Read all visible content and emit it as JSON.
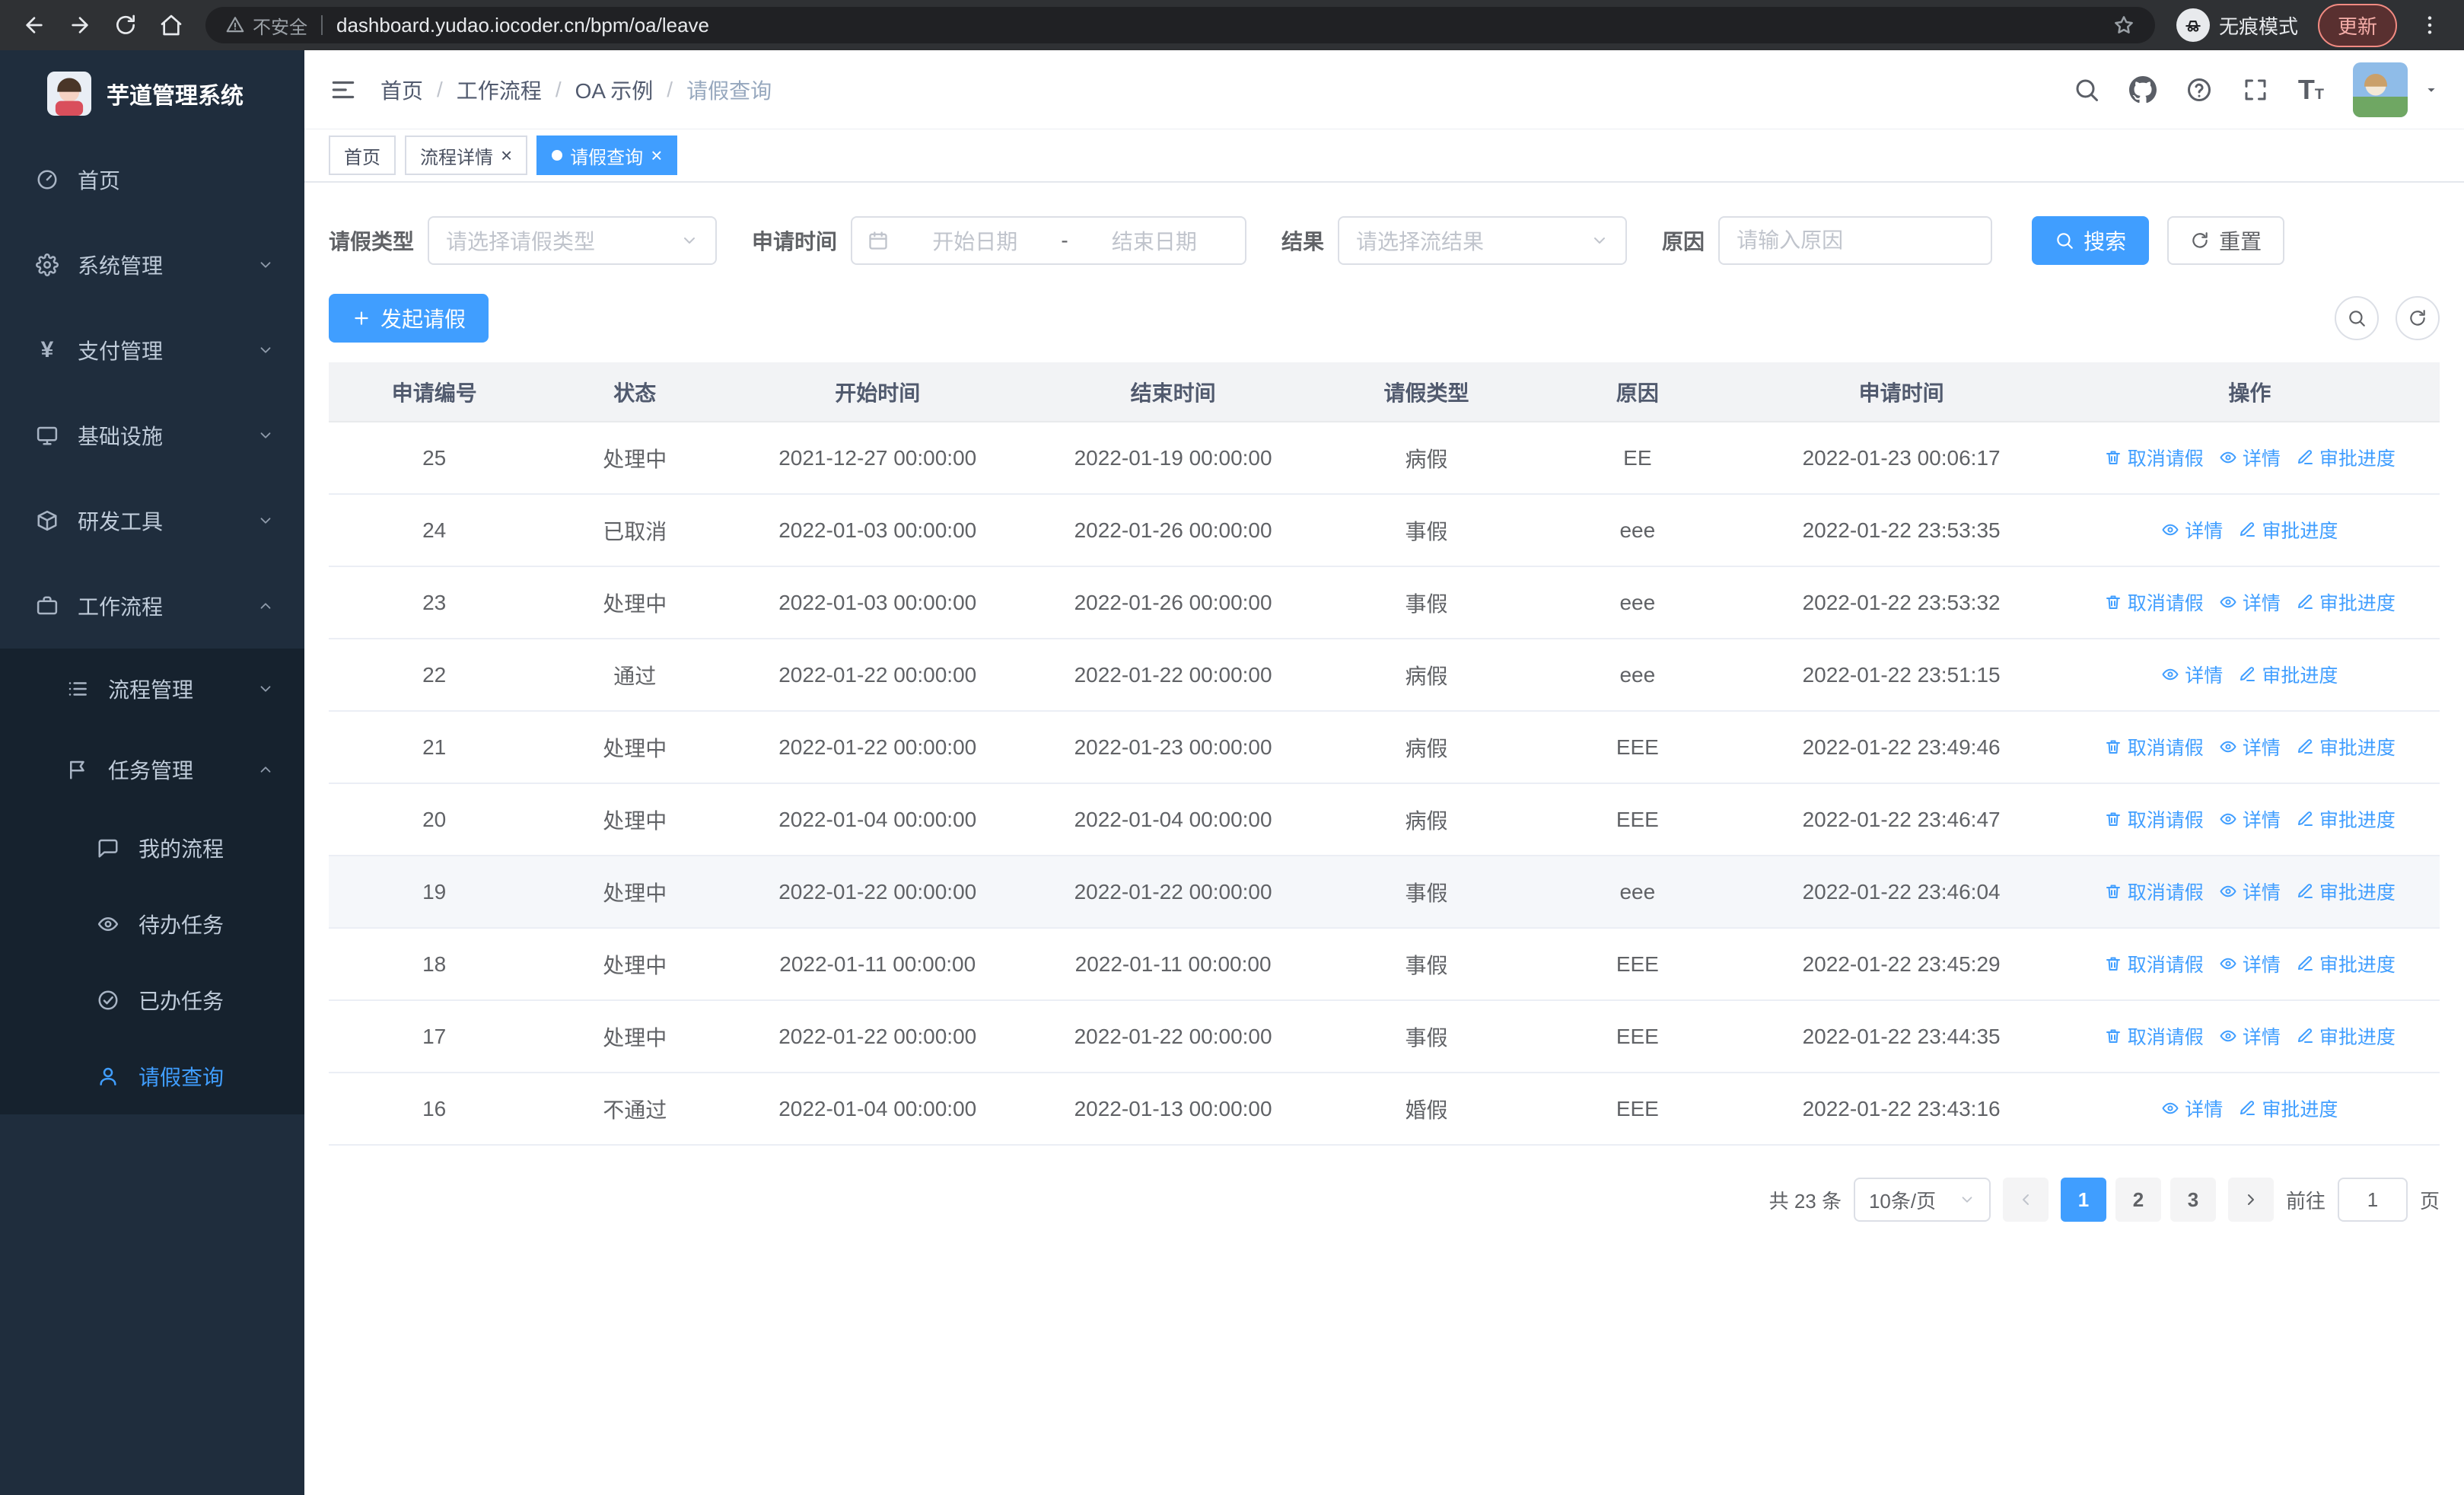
{
  "colors": {
    "accent": "#409eff",
    "sidebar_bg": "#1f2d3d",
    "submenu_bg": "#16222e",
    "update_red": "#f28b82",
    "table_header_bg": "#f2f3f5"
  },
  "browser": {
    "security_label": "不安全",
    "url": "dashboard.yudao.iocoder.cn/bpm/oa/leave",
    "incognito_label": "无痕模式",
    "update_label": "更新"
  },
  "sidebar": {
    "logo_title": "芋道管理系统",
    "menu": [
      {
        "key": "home",
        "label": "首页",
        "icon": "dashboard-icon"
      },
      {
        "key": "system",
        "label": "系统管理",
        "icon": "gear-icon",
        "chevron": "down"
      },
      {
        "key": "payment",
        "label": "支付管理",
        "icon": "yen-icon",
        "chevron": "down"
      },
      {
        "key": "infrastructure",
        "label": "基础设施",
        "icon": "monitor-icon",
        "chevron": "down"
      },
      {
        "key": "devtools",
        "label": "研发工具",
        "icon": "box-icon",
        "chevron": "down"
      },
      {
        "key": "workflow",
        "label": "工作流程",
        "icon": "briefcase-icon",
        "chevron": "up",
        "children": [
          {
            "key": "process-mgmt",
            "label": "流程管理",
            "icon": "list-icon",
            "chevron": "down"
          },
          {
            "key": "task-mgmt",
            "label": "任务管理",
            "icon": "flag-icon",
            "chevron": "up",
            "children": [
              {
                "key": "my-process",
                "label": "我的流程",
                "icon": "chat-icon"
              },
              {
                "key": "todo-task",
                "label": "待办任务",
                "icon": "eye-icon"
              },
              {
                "key": "done-task",
                "label": "已办任务",
                "icon": "check-icon"
              },
              {
                "key": "leave-query",
                "label": "请假查询",
                "icon": "user-icon",
                "active": true
              }
            ]
          }
        ]
      }
    ]
  },
  "header": {
    "breadcrumb": [
      "首页",
      "工作流程",
      "OA 示例",
      "请假查询"
    ],
    "icons": [
      "search-icon",
      "github-icon",
      "question-icon",
      "fullscreen-icon",
      "font-size-icon"
    ]
  },
  "tabs": [
    {
      "key": "home",
      "label": "首页",
      "active": false,
      "closable": false
    },
    {
      "key": "process-detail",
      "label": "流程详情",
      "active": false,
      "closable": true
    },
    {
      "key": "leave-query",
      "label": "请假查询",
      "active": true,
      "closable": true
    }
  ],
  "filters": {
    "leave_type": {
      "label": "请假类型",
      "placeholder": "请选择请假类型"
    },
    "apply_time": {
      "label": "申请时间",
      "start_placeholder": "开始日期",
      "separator": "-",
      "end_placeholder": "结束日期"
    },
    "result": {
      "label": "结果",
      "placeholder": "请选择流结果"
    },
    "reason": {
      "label": "原因",
      "placeholder": "请输入原因"
    },
    "search_label": "搜索",
    "reset_label": "重置"
  },
  "toolbar": {
    "create_label": "发起请假"
  },
  "table": {
    "columns": [
      "申请编号",
      "状态",
      "开始时间",
      "结束时间",
      "请假类型",
      "原因",
      "申请时间",
      "操作"
    ],
    "action_labels": {
      "cancel": "取消请假",
      "detail": "详情",
      "progress": "审批进度"
    },
    "rows": [
      {
        "id": "25",
        "status": "处理中",
        "start": "2021-12-27 00:00:00",
        "end": "2022-01-19 00:00:00",
        "type": "病假",
        "reason": "EE",
        "applied": "2022-01-23 00:06:17",
        "actions": [
          "cancel",
          "detail",
          "progress"
        ],
        "highlight": false
      },
      {
        "id": "24",
        "status": "已取消",
        "start": "2022-01-03 00:00:00",
        "end": "2022-01-26 00:00:00",
        "type": "事假",
        "reason": "eee",
        "applied": "2022-01-22 23:53:35",
        "actions": [
          "detail",
          "progress"
        ],
        "highlight": false
      },
      {
        "id": "23",
        "status": "处理中",
        "start": "2022-01-03 00:00:00",
        "end": "2022-01-26 00:00:00",
        "type": "事假",
        "reason": "eee",
        "applied": "2022-01-22 23:53:32",
        "actions": [
          "cancel",
          "detail",
          "progress"
        ],
        "highlight": false
      },
      {
        "id": "22",
        "status": "通过",
        "start": "2022-01-22 00:00:00",
        "end": "2022-01-22 00:00:00",
        "type": "病假",
        "reason": "eee",
        "applied": "2022-01-22 23:51:15",
        "actions": [
          "detail",
          "progress"
        ],
        "highlight": false
      },
      {
        "id": "21",
        "status": "处理中",
        "start": "2022-01-22 00:00:00",
        "end": "2022-01-23 00:00:00",
        "type": "病假",
        "reason": "EEE",
        "applied": "2022-01-22 23:49:46",
        "actions": [
          "cancel",
          "detail",
          "progress"
        ],
        "highlight": false
      },
      {
        "id": "20",
        "status": "处理中",
        "start": "2022-01-04 00:00:00",
        "end": "2022-01-04 00:00:00",
        "type": "病假",
        "reason": "EEE",
        "applied": "2022-01-22 23:46:47",
        "actions": [
          "cancel",
          "detail",
          "progress"
        ],
        "highlight": false
      },
      {
        "id": "19",
        "status": "处理中",
        "start": "2022-01-22 00:00:00",
        "end": "2022-01-22 00:00:00",
        "type": "事假",
        "reason": "eee",
        "applied": "2022-01-22 23:46:04",
        "actions": [
          "cancel",
          "detail",
          "progress"
        ],
        "highlight": true
      },
      {
        "id": "18",
        "status": "处理中",
        "start": "2022-01-11 00:00:00",
        "end": "2022-01-11 00:00:00",
        "type": "事假",
        "reason": "EEE",
        "applied": "2022-01-22 23:45:29",
        "actions": [
          "cancel",
          "detail",
          "progress"
        ],
        "highlight": false
      },
      {
        "id": "17",
        "status": "处理中",
        "start": "2022-01-22 00:00:00",
        "end": "2022-01-22 00:00:00",
        "type": "事假",
        "reason": "EEE",
        "applied": "2022-01-22 23:44:35",
        "actions": [
          "cancel",
          "detail",
          "progress"
        ],
        "highlight": false
      },
      {
        "id": "16",
        "status": "不通过",
        "start": "2022-01-04 00:00:00",
        "end": "2022-01-13 00:00:00",
        "type": "婚假",
        "reason": "EEE",
        "applied": "2022-01-22 23:43:16",
        "actions": [
          "detail",
          "progress"
        ],
        "highlight": false
      }
    ]
  },
  "pagination": {
    "total_label": "共 23 条",
    "page_size_label": "10条/页",
    "pages": [
      "1",
      "2",
      "3"
    ],
    "active_page": "1",
    "goto_label": "前往",
    "goto_value": "1",
    "unit_label": "页"
  }
}
